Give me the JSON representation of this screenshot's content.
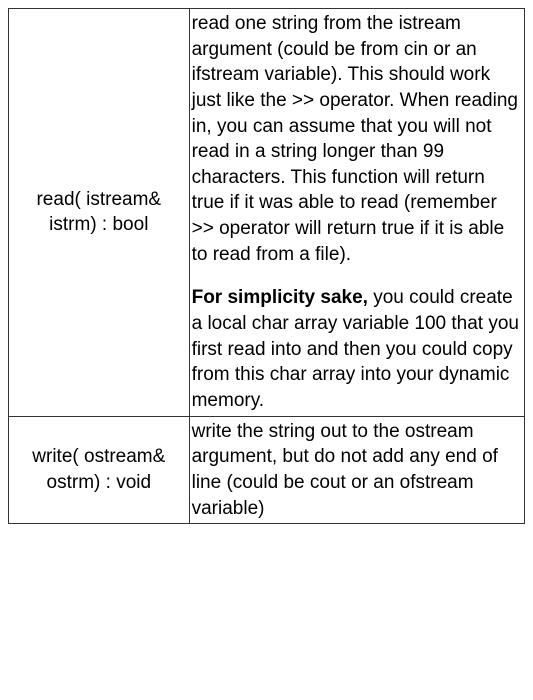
{
  "rows": [
    {
      "signature": "read( istream& istrm) : bool",
      "desc_p1": "read one string from the istream argument (could be from cin or an ifstream variable).  This should work just like the >> operator.  When reading in, you can assume that you will not read in a string longer than 99 characters. This function will return true if it was able to read (remember >> operator will return true if it is able to read from a file).",
      "desc_p2_bold": "For simplicity sake,",
      "desc_p2_rest": " you could create a local char array variable 100 that you first read into and then you could copy from this char array into your dynamic memory."
    },
    {
      "signature": "write( ostream& ostrm) : void",
      "desc_p1": "write the string out to the ostream argument, but do not add any end of line (could be cout or an ofstream variable)"
    }
  ]
}
